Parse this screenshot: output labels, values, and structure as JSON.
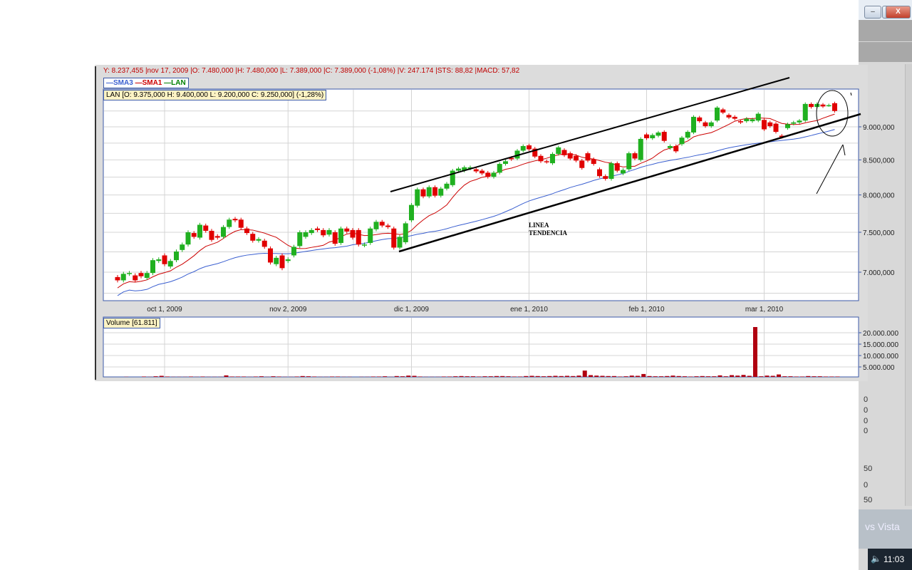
{
  "window": {
    "minimize_label": "–",
    "maximize_label": "□",
    "close_label": "X",
    "clock": "11:03",
    "background_fragment": "vs Vista",
    "fragments": [
      "0",
      "0",
      "0",
      "0",
      "50",
      "0",
      "50"
    ]
  },
  "header": {
    "info_line": "Y: 8.237,455 |nov 17, 2009 |O: 7.480,000 |H: 7.480,000 |L: 7.389,000 |C: 7.389,000 (-1,08%) |V: 247.174 |STS: 88,82 |MACD: 57,82",
    "legend": [
      {
        "label": "SMA3",
        "color": "#3a5fd0"
      },
      {
        "label": "SMA1",
        "color": "#cc0000"
      },
      {
        "label": "LAN",
        "color": "#008000"
      }
    ],
    "lan_info": "LAN [O: 9.375,000  H: 9.400,000  L: 9.200,000  C: 9.250,000] (-1,28%)",
    "volume_info": "Volume [61.811]"
  },
  "chart_data": {
    "type": "candlestick",
    "symbol": "LAN",
    "scale": "log",
    "ylim": [
      6700000,
      9500000
    ],
    "x_ticks": [
      "oct 1, 2009",
      "nov 2, 2009",
      "dic 1, 2009",
      "ene 1, 2010",
      "feb 1, 2010",
      "mar 1, 2010"
    ],
    "x_tick_index": [
      8,
      29,
      50,
      70,
      90,
      110
    ],
    "y_ticks": [
      {
        "value": 9000000,
        "label": "9.000,000"
      },
      {
        "value": 8500000,
        "label": "8.500,000"
      },
      {
        "value": 8000000,
        "label": "8.000,000"
      },
      {
        "value": 7500000,
        "label": "7.500,000"
      },
      {
        "value": 7000000,
        "label": "7.000,000"
      }
    ],
    "up_color": "#20b020",
    "down_color": "#e00000",
    "open_k": [
      6941,
      6902,
      6980,
      6961,
      6990,
      6931,
      6990,
      7137,
      7206,
      7069,
      7147,
      7274,
      7343,
      7490,
      7431,
      7588,
      7519,
      7451,
      7441,
      7569,
      7676,
      7666,
      7549,
      7480,
      7392,
      7392,
      7294,
      7098,
      7206,
      7137,
      7206,
      7323,
      7441,
      7490,
      7549,
      7529,
      7470,
      7500,
      7363,
      7549,
      7529,
      7529,
      7333,
      7363,
      7539,
      7637,
      7588,
      7549,
      7304,
      7372,
      7657,
      7853,
      8078,
      7980,
      8108,
      7990,
      8088,
      8137,
      8343,
      8343,
      8373,
      8363,
      8343,
      8314,
      8255,
      8314,
      8441,
      8529,
      8520,
      8637,
      8716,
      8667,
      8559,
      8480,
      8451,
      8588,
      8647,
      8598,
      8559,
      8490,
      8598,
      8510,
      8363,
      8265,
      8226,
      8451,
      8304,
      8363,
      8598,
      8500,
      8882,
      8824,
      8863,
      8922,
      8676,
      8706,
      8735,
      8833,
      8912,
      9147,
      9069,
      9010,
      9098,
      9274,
      9186,
      9157,
      9088,
      9088,
      9088,
      9098,
      9108,
      9069,
      9049,
      8863,
      8980,
      9049,
      9069,
      9098,
      9363,
      9314,
      9353,
      9343,
      9375
    ],
    "close_k": [
      6902,
      6980,
      6990,
      6902,
      6951,
      6990,
      7147,
      7157,
      7098,
      7137,
      7255,
      7343,
      7500,
      7441,
      7598,
      7519,
      7402,
      7431,
      7569,
      7666,
      7657,
      7559,
      7490,
      7392,
      7412,
      7314,
      7118,
      7176,
      7049,
      7157,
      7314,
      7500,
      7500,
      7529,
      7529,
      7461,
      7529,
      7353,
      7549,
      7510,
      7431,
      7343,
      7343,
      7549,
      7637,
      7588,
      7569,
      7304,
      7441,
      7617,
      7863,
      8078,
      7980,
      8108,
      7990,
      8088,
      8157,
      8343,
      8373,
      8392,
      8392,
      8333,
      8304,
      8255,
      8314,
      8441,
      8480,
      8510,
      8637,
      8706,
      8657,
      8549,
      8480,
      8470,
      8588,
      8686,
      8569,
      8520,
      8490,
      8382,
      8490,
      8441,
      8265,
      8226,
      8451,
      8343,
      8353,
      8598,
      8520,
      8814,
      8824,
      8873,
      8912,
      8784,
      8706,
      8627,
      8833,
      8922,
      9157,
      9088,
      9010,
      9069,
      9304,
      9225,
      9147,
      9127,
      9069,
      9127,
      9118,
      9206,
      8961,
      9010,
      8922,
      8843,
      9040,
      9069,
      9098,
      9363,
      9314,
      9363,
      9323,
      9343,
      9250
    ],
    "sma_series": [
      {
        "name": "SMA1",
        "period": 10,
        "color": "#cc0000"
      },
      {
        "name": "SMA3",
        "period": 40,
        "color": "#3a5fd0"
      }
    ],
    "volume": {
      "label": "Volume",
      "unit": "millions",
      "y_ticks": [
        {
          "value": 20,
          "label": "20.000.000"
        },
        {
          "value": 15,
          "label": "15.000.000"
        },
        {
          "value": 10,
          "label": "10.000.000"
        },
        {
          "value": 5,
          "label": "5.000.000"
        }
      ],
      "values_m": [
        0.6,
        0.7,
        0.6,
        0.6,
        0.8,
        0.7,
        0.9,
        1.1,
        0.8,
        0.7,
        0.7,
        0.7,
        0.8,
        0.7,
        0.8,
        0.7,
        0.7,
        0.7,
        1.3,
        0.8,
        0.8,
        0.8,
        0.7,
        0.8,
        0.9,
        0.7,
        0.9,
        0.8,
        0.7,
        0.7,
        0.8,
        1.0,
        0.9,
        0.8,
        0.7,
        0.7,
        0.8,
        0.8,
        0.7,
        0.7,
        0.6,
        0.7,
        0.7,
        0.8,
        0.8,
        0.9,
        0.7,
        1.0,
        0.9,
        1.2,
        1.1,
        0.8,
        0.7,
        0.7,
        0.7,
        0.8,
        0.8,
        0.9,
        1.0,
        0.9,
        0.9,
        0.8,
        0.9,
        0.9,
        1.0,
        1.0,
        0.9,
        0.8,
        0.8,
        1.0,
        1.1,
        1.0,
        0.9,
        1.0,
        1.1,
        1.0,
        1.1,
        1.0,
        1.2,
        3.4,
        1.4,
        1.2,
        1.1,
        1.0,
        1.0,
        0.8,
        0.9,
        1.2,
        1.1,
        1.9,
        1.0,
        0.9,
        0.9,
        1.0,
        1.2,
        1.0,
        0.9,
        0.8,
        0.9,
        1.0,
        0.9,
        0.9,
        1.3,
        0.9,
        1.4,
        1.2,
        1.5,
        1.1,
        22.5,
        0.9,
        1.2,
        1.1,
        1.7,
        0.9,
        0.9,
        0.8,
        0.8,
        1.0,
        0.9,
        0.9,
        0.8,
        0.8,
        0.8
      ]
    },
    "annotations": [
      {
        "type": "text",
        "text": "LINEA TENDENCIA"
      },
      {
        "type": "trendline",
        "name": "channel-upper"
      },
      {
        "type": "trendline",
        "name": "channel-lower"
      },
      {
        "type": "ellipse",
        "name": "highlight-circle"
      },
      {
        "type": "arrow",
        "name": "pointer-arrow"
      }
    ]
  }
}
